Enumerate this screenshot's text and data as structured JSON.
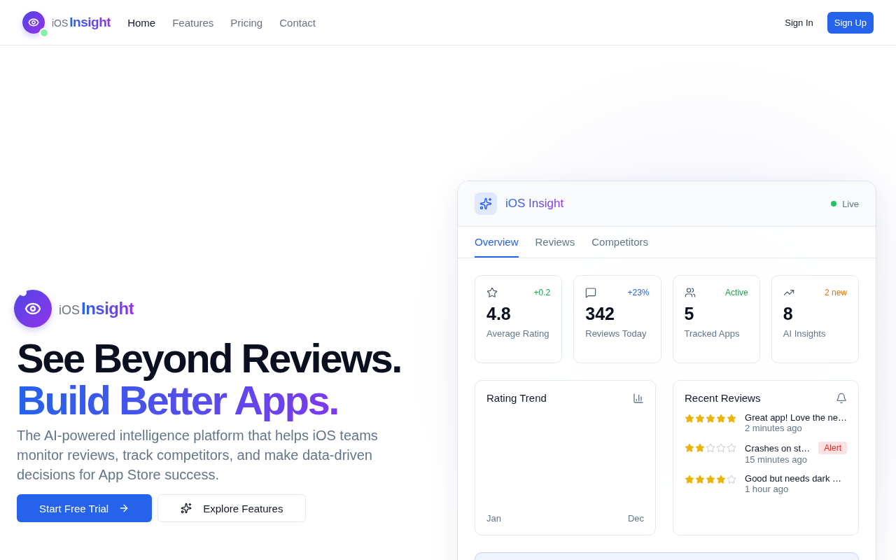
{
  "nav": {
    "logo": {
      "prefix": "iOS",
      "name": "Insight"
    },
    "links": [
      {
        "label": "Home",
        "selected": true
      },
      {
        "label": "Features",
        "selected": false
      },
      {
        "label": "Pricing",
        "selected": false
      },
      {
        "label": "Contact",
        "selected": false
      }
    ],
    "sign_in": "Sign In",
    "sign_up": "Sign Up"
  },
  "hero": {
    "logo": {
      "prefix": "iOS",
      "name": "Insight"
    },
    "headline": "See Beyond Reviews.",
    "headline_accent": "Build Better Apps.",
    "description": "The AI-powered intelligence platform that helps iOS teams monitor reviews, track competitors, and make data-driven decisions for App Store success.",
    "primary_button": "Start Free Trial",
    "secondary_button": "Explore Features"
  },
  "dashboard": {
    "title": "iOS Insight",
    "status": "Live",
    "tabs": [
      {
        "label": "Overview",
        "selected": true
      },
      {
        "label": "Reviews",
        "selected": false
      },
      {
        "label": "Competitors",
        "selected": false
      }
    ],
    "stats": [
      {
        "kind": "star",
        "badge": "+0.2",
        "color": "#16a34a",
        "value": "4.8",
        "label": "Average Rating"
      },
      {
        "kind": "message",
        "badge": "+23%",
        "color": "#2563eb",
        "value": "342",
        "label": "Reviews Today"
      },
      {
        "kind": "users",
        "badge": "Active",
        "color": "#16a34a",
        "value": "5",
        "label": "Tracked Apps"
      },
      {
        "kind": "trend",
        "badge": "2 new",
        "color": "#d97706",
        "value": "8",
        "label": "AI Insights"
      }
    ],
    "trend": {
      "title": "Rating Trend",
      "start": "Jan",
      "end": "Dec"
    },
    "reviews": {
      "title": "Recent Reviews",
      "items": [
        {
          "stars": 5,
          "text": "Great app! Love the ne…",
          "time": "2 minutes ago"
        },
        {
          "stars": 2,
          "text": "Crashes on st…",
          "time": "15 minutes ago",
          "tag": "Alert"
        },
        {
          "stars": 4,
          "text": "Good but needs dark …",
          "time": "1 hour ago"
        }
      ]
    }
  }
}
